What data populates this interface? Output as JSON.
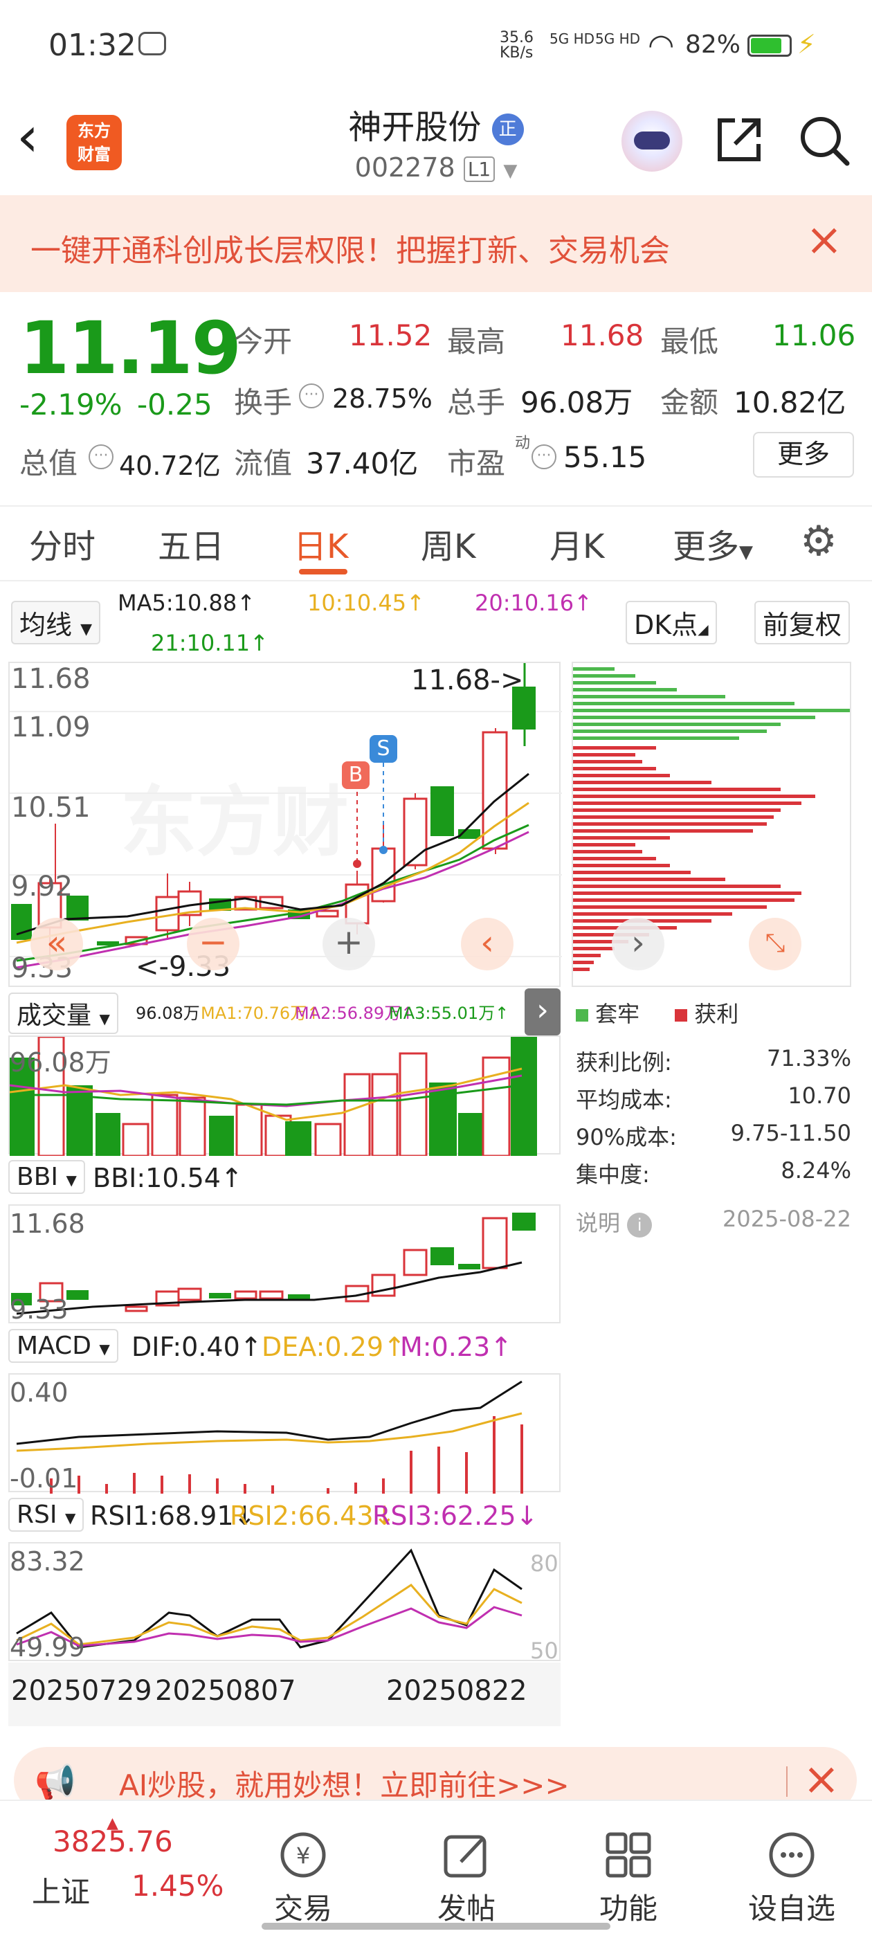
{
  "status": {
    "time": "01:32",
    "speed": "35.6\nKB/s",
    "net1": "5G HD",
    "net2": "5G HD",
    "battery": "82%"
  },
  "header": {
    "title": "神开股份",
    "title_badge": "正",
    "code": "002278",
    "level": "L1",
    "logo_top": "东方",
    "logo_bottom": "财富"
  },
  "banner": {
    "text": "一键开通科创成长层权限！把握打新、交易机会"
  },
  "quote": {
    "price": "11.19",
    "change_pct": "-2.19%",
    "change": "-0.25",
    "open_label": "今开",
    "open": "11.52",
    "high_label": "最高",
    "high": "11.68",
    "low_label": "最低",
    "low": "11.06",
    "turnover_label": "换手",
    "turnover": "28.75%",
    "volume_label": "总手",
    "volume": "96.08万",
    "amount_label": "金额",
    "amount": "10.82亿",
    "mktcap_label": "总值",
    "mktcap": "40.72亿",
    "float_label": "流值",
    "float": "37.40亿",
    "pe_label": "市盈",
    "pe_sup": "动",
    "pe": "55.15",
    "more": "更多"
  },
  "tabs": [
    "分时",
    "五日",
    "日K",
    "周K",
    "月K",
    "更多"
  ],
  "active_tab": 2,
  "ma": {
    "selector": "均线",
    "ma5": "MA5:10.88↑",
    "ma10": "10:10.45↑",
    "ma20": "20:10.16↑",
    "ma21": "21:10.11↑",
    "dk": "DK点",
    "adjust": "前复权"
  },
  "kline": {
    "y_top": "11.68",
    "y_2": "11.09",
    "y_3": "10.51",
    "y_4": "9.92",
    "y_bottom": "9.33",
    "max_label": "11.68->",
    "min_label": "<-9.33",
    "b": "B",
    "s": "S"
  },
  "volume": {
    "selector": "成交量",
    "v": "96.08万",
    "ma1": "MA1:70.76万↑",
    "ma2": "MA2:56.89万↑",
    "ma3": "MA3:55.01万↑",
    "y_top": "96.08万"
  },
  "bbi": {
    "selector": "BBI",
    "value": "BBI:10.54↑",
    "y_top": "11.68",
    "y_bottom": "9.33"
  },
  "macd": {
    "selector": "MACD",
    "dif": "DIF:0.40↑",
    "dea": "DEA:0.29↑",
    "m": "M:0.23↑",
    "y_top": "0.40",
    "y_bottom": "-0.01"
  },
  "rsi": {
    "selector": "RSI",
    "rsi1": "RSI1:68.91↓",
    "rsi2": "RSI2:66.43↓",
    "rsi3": "RSI3:62.25↓",
    "y_top": "83.32",
    "y_bottom": "49.99",
    "r80": "80",
    "r50": "50"
  },
  "dates": {
    "d1": "20250729",
    "d2": "20250807",
    "d3": "20250822"
  },
  "chips": {
    "legend_trapped": "套牢",
    "legend_profit": "获利",
    "rows": [
      {
        "label": "获利比例:",
        "value": "71.33%"
      },
      {
        "label": "平均成本:",
        "value": "10.70"
      },
      {
        "label": "90%成本:",
        "value": "9.75-11.50"
      },
      {
        "label": "集中度:",
        "value": "8.24%"
      }
    ],
    "note": "说明",
    "date": "2025-08-22"
  },
  "ad": {
    "text": "AI炒股，就用妙想！立即前往>>>"
  },
  "bottom": {
    "index_value": "3825.76",
    "index_name": "上证",
    "index_change": "1.45%",
    "nav": [
      "交易",
      "发帖",
      "功能",
      "设自选"
    ]
  },
  "colors": {
    "up": "#d9343a",
    "down": "#1a9a1a",
    "accent": "#e8592a",
    "ma10": "#e8b020",
    "ma20": "#c02fb0"
  }
}
